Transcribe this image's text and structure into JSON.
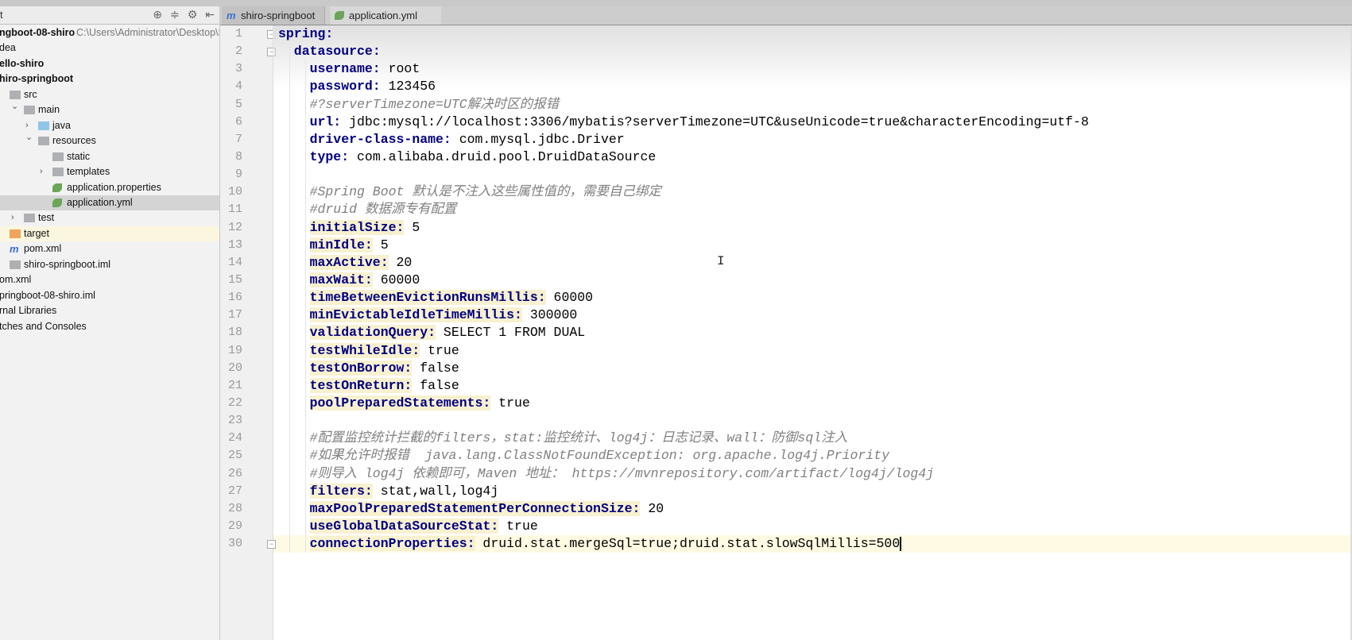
{
  "sidebar": {
    "title": "t",
    "tools": [
      "locate-icon",
      "collapse-icon",
      "gear-icon",
      "hide-icon"
    ],
    "tree": [
      {
        "label": "ngboot-08-shiro",
        "path": "C:\\Users\\Administrator\\Desktop\\S",
        "bold": true,
        "icon": "none",
        "indent": 0
      },
      {
        "label": "dea",
        "icon": "none",
        "indent": 0
      },
      {
        "label": "ello-shiro",
        "bold": true,
        "icon": "none",
        "indent": 0
      },
      {
        "label": "hiro-springboot",
        "bold": true,
        "icon": "none",
        "indent": 0
      },
      {
        "label": "src",
        "icon": "folder",
        "indent": 1
      },
      {
        "label": "main",
        "icon": "folder",
        "indent": 2,
        "arrow": "down"
      },
      {
        "label": "java",
        "icon": "folder-blue",
        "indent": 3,
        "arrow": "right"
      },
      {
        "label": "resources",
        "icon": "folder-resources",
        "indent": 3,
        "arrow": "down"
      },
      {
        "label": "static",
        "icon": "folder",
        "indent": 4
      },
      {
        "label": "templates",
        "icon": "folder",
        "indent": 4,
        "arrow": "right"
      },
      {
        "label": "application.properties",
        "icon": "spring-leaf",
        "indent": 4
      },
      {
        "label": "application.yml",
        "icon": "spring-leaf",
        "indent": 4,
        "selected": true
      },
      {
        "label": "test",
        "icon": "folder",
        "indent": 2,
        "arrow": "right"
      },
      {
        "label": "target",
        "icon": "folder-orange",
        "indent": 1,
        "highlight": true
      },
      {
        "label": "pom.xml",
        "icon": "maven",
        "indent": 1
      },
      {
        "label": "shiro-springboot.iml",
        "icon": "module",
        "indent": 1
      },
      {
        "label": "om.xml",
        "icon": "none",
        "indent": 0
      },
      {
        "label": "pringboot-08-shiro.iml",
        "icon": "none",
        "indent": 0
      },
      {
        "label": "rnal Libraries",
        "icon": "none",
        "indent": 0
      },
      {
        "label": "tches and Consoles",
        "icon": "none",
        "indent": 0
      }
    ]
  },
  "tabs": [
    {
      "label": "shiro-springboot",
      "icon": "maven-icon",
      "close": "×",
      "active": false
    },
    {
      "label": "application.yml",
      "icon": "spring-leaf-icon",
      "active": true
    }
  ],
  "colors": {
    "key": "#000080",
    "comment": "#808080",
    "key_highlight": "#f8f1d0",
    "current_line": "#fffae3"
  },
  "editor": {
    "current_line": 30,
    "lines": [
      {
        "n": "1",
        "indent": 0,
        "key": "spring:",
        "value": ""
      },
      {
        "n": "2",
        "indent": 2,
        "key": "datasource:",
        "value": ""
      },
      {
        "n": "3",
        "indent": 4,
        "key": "username:",
        "value": " root"
      },
      {
        "n": "4",
        "indent": 4,
        "key": "password:",
        "value": " 123456"
      },
      {
        "n": "5",
        "indent": 4,
        "comment": "#?serverTimezone=UTC解决时区的报错"
      },
      {
        "n": "6",
        "indent": 4,
        "key": "url:",
        "value": " jdbc:mysql://localhost:3306/mybatis?serverTimezone=UTC&useUnicode=true&characterEncoding=utf-8"
      },
      {
        "n": "7",
        "indent": 4,
        "key": "driver-class-name:",
        "value": " com.mysql.jdbc.Driver"
      },
      {
        "n": "8",
        "indent": 4,
        "key": "type:",
        "value": " com.alibaba.druid.pool.DruidDataSource"
      },
      {
        "n": "9",
        "indent": 0
      },
      {
        "n": "10",
        "indent": 4,
        "comment": "#Spring Boot 默认是不注入这些属性值的，需要自己绑定"
      },
      {
        "n": "11",
        "indent": 4,
        "comment": "#druid 数据源专有配置"
      },
      {
        "n": "12",
        "indent": 4,
        "key": "initialSize:",
        "value": " 5",
        "hl": true
      },
      {
        "n": "13",
        "indent": 4,
        "key": "minIdle:",
        "value": " 5",
        "hl": true
      },
      {
        "n": "14",
        "indent": 4,
        "key": "maxActive:",
        "value": " 20",
        "hl": true
      },
      {
        "n": "15",
        "indent": 4,
        "key": "maxWait:",
        "value": " 60000",
        "hl": true
      },
      {
        "n": "16",
        "indent": 4,
        "key": "timeBetweenEvictionRunsMillis:",
        "value": " 60000",
        "hl": true
      },
      {
        "n": "17",
        "indent": 4,
        "key": "minEvictableIdleTimeMillis:",
        "value": " 300000",
        "hl": true
      },
      {
        "n": "18",
        "indent": 4,
        "key": "validationQuery:",
        "value": " SELECT 1 FROM DUAL",
        "hl": true
      },
      {
        "n": "19",
        "indent": 4,
        "key": "testWhileIdle:",
        "value": " true",
        "hl": true
      },
      {
        "n": "20",
        "indent": 4,
        "key": "testOnBorrow:",
        "value": " false",
        "hl": true
      },
      {
        "n": "21",
        "indent": 4,
        "key": "testOnReturn:",
        "value": " false",
        "hl": true
      },
      {
        "n": "22",
        "indent": 4,
        "key": "poolPreparedStatements:",
        "value": " true",
        "hl": true
      },
      {
        "n": "23",
        "indent": 0
      },
      {
        "n": "24",
        "indent": 4,
        "comment": "#配置监控统计拦截的filters，stat:监控统计、log4j：日志记录、wall：防御sql注入"
      },
      {
        "n": "25",
        "indent": 4,
        "comment": "#如果允许时报错  java.lang.ClassNotFoundException: org.apache.log4j.Priority"
      },
      {
        "n": "26",
        "indent": 4,
        "comment": "#则导入 log4j 依赖即可，Maven 地址： https://mvnrepository.com/artifact/log4j/log4j"
      },
      {
        "n": "27",
        "indent": 4,
        "key": "filters:",
        "value": " stat,wall,log4j",
        "hl": true
      },
      {
        "n": "28",
        "indent": 4,
        "key": "maxPoolPreparedStatementPerConnectionSize:",
        "value": " 20",
        "hl": true
      },
      {
        "n": "29",
        "indent": 4,
        "key": "useGlobalDataSourceStat:",
        "value": " true",
        "hl": true
      },
      {
        "n": "30",
        "indent": 4,
        "key": "connectionProperties:",
        "value": " druid.stat.mergeSql=true;druid.stat.slowSqlMillis=500",
        "hl": true
      }
    ]
  }
}
